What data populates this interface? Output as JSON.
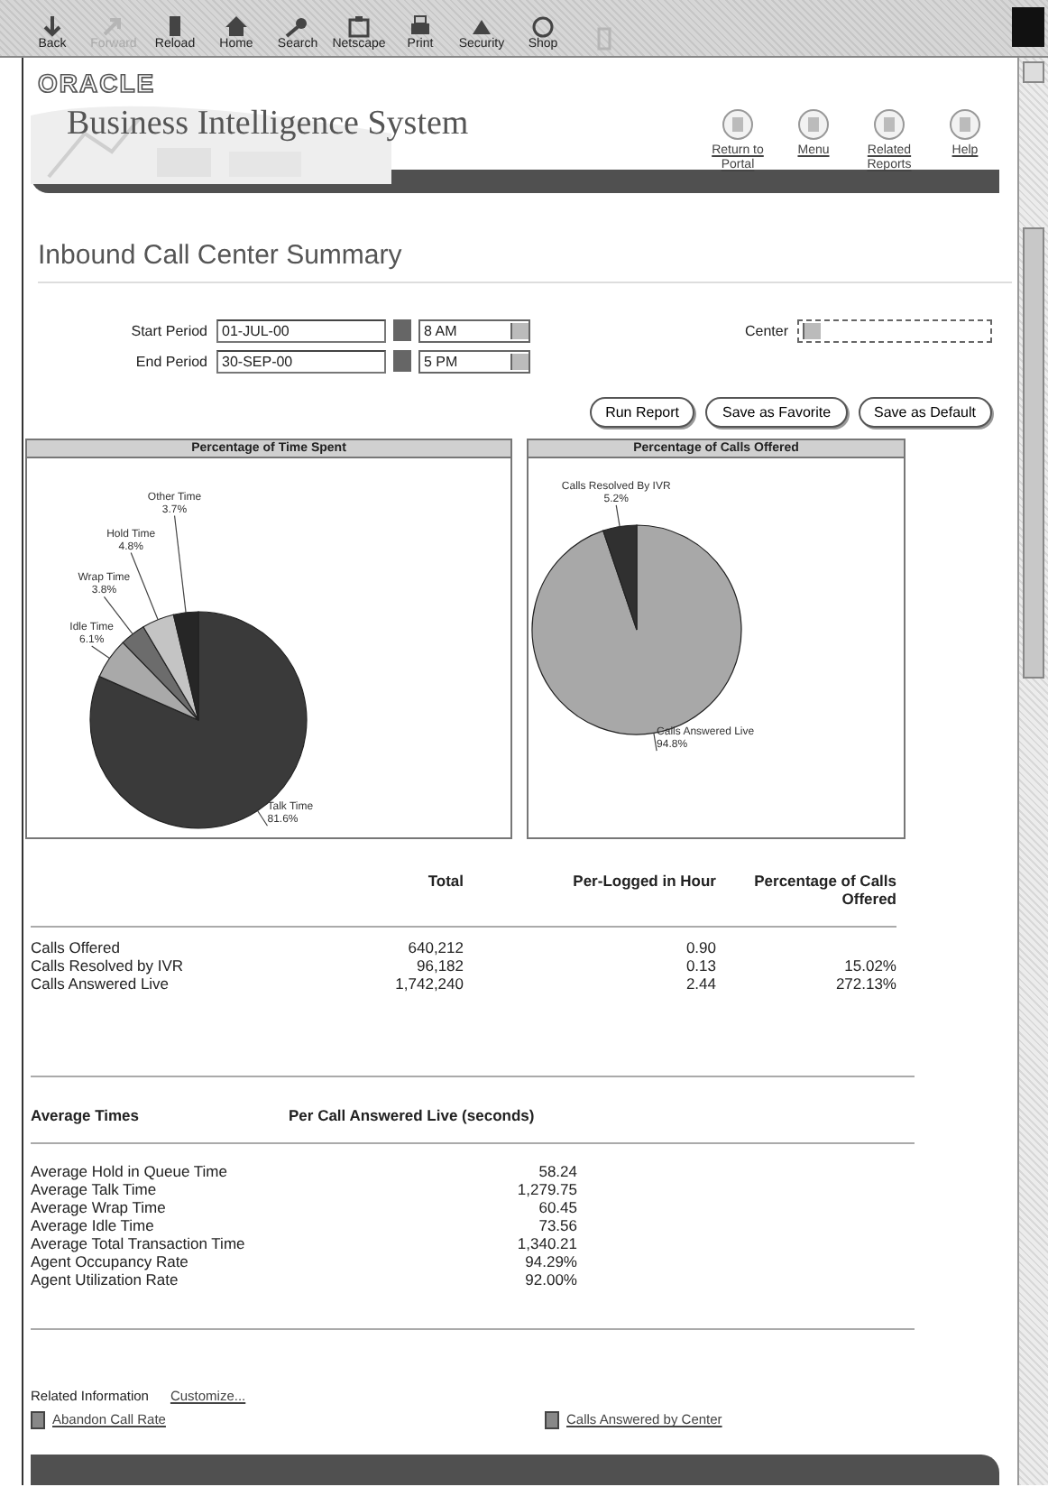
{
  "browser_toolbar": {
    "buttons": [
      {
        "kind": "labeled",
        "label": "Back",
        "disabled": false
      },
      {
        "kind": "labeled",
        "label": "Forward",
        "disabled": true
      },
      {
        "kind": "labeled",
        "label": "Reload",
        "disabled": false
      },
      {
        "kind": "labeled",
        "label": "Home",
        "disabled": false
      },
      {
        "kind": "labeled",
        "label": "Search",
        "disabled": false
      },
      {
        "kind": "labeled",
        "label": "Netscape",
        "disabled": false
      },
      {
        "kind": "labeled",
        "label": "Print",
        "disabled": false
      },
      {
        "kind": "labeled",
        "label": "Security",
        "disabled": false
      },
      {
        "kind": "labeled",
        "label": "Shop",
        "disabled": false
      },
      {
        "kind": "icon",
        "disabled": true
      }
    ]
  },
  "header": {
    "logo": "ORACLE",
    "title": "Business Intelligence System",
    "links": [
      {
        "label": "Return to Portal"
      },
      {
        "label": "Menu"
      },
      {
        "label": "Related Reports"
      },
      {
        "label": "Help"
      }
    ]
  },
  "report": {
    "title": "Inbound Call Center Summary",
    "start_period": {
      "label": "Start Period",
      "value": "01-JUL-00",
      "time": "8 AM"
    },
    "end_period": {
      "label": "End Period",
      "value": "30-SEP-00",
      "time": "5 PM"
    },
    "center": {
      "label": "Center"
    },
    "buttons": [
      "Run Report",
      "Save as Favorite",
      "Save as Default"
    ]
  },
  "charts": [
    {
      "chart_data": {
        "type": "pie",
        "title": "Percentage of Time Spent",
        "categories": [
          "Talk Time",
          "Idle Time",
          "Wrap Time",
          "Hold Time",
          "Other Time"
        ],
        "values": [
          81.6,
          6.1,
          3.8,
          4.8,
          3.7
        ],
        "value_labels": [
          "81.6%",
          "6.1%",
          "3.8%",
          "4.8%",
          "3.7%"
        ]
      }
    },
    {
      "chart_data": {
        "type": "pie",
        "title": "Percentage of Calls Offered",
        "categories": [
          "Calls Answered Live",
          "Calls Resolved By IVR"
        ],
        "values": [
          94.8,
          5.2
        ],
        "value_labels": [
          "94.8%",
          "5.2%"
        ]
      }
    }
  ],
  "calls_table": {
    "columns": [
      "Total",
      "Per-Logged in Hour",
      "Percentage of Calls Offered"
    ],
    "rows": [
      {
        "label": "Calls Offered",
        "cells": [
          "640,212",
          "0.90",
          ""
        ]
      },
      {
        "label": "Calls Resolved by IVR",
        "cells": [
          "96,182",
          "0.13",
          "15.02%"
        ]
      },
      {
        "label": "Calls Answered Live",
        "cells": [
          "1,742,240",
          "2.44",
          "272.13%"
        ]
      }
    ]
  },
  "times_table": {
    "columns": [
      "Average Times",
      "Per Call Answered Live (seconds)"
    ],
    "rows": [
      {
        "label": "Average Hold in Queue Time",
        "value": "58.24"
      },
      {
        "label": "Average Talk Time",
        "value": "1,279.75"
      },
      {
        "label": "Average Wrap Time",
        "value": "60.45"
      },
      {
        "label": "Average Idle Time",
        "value": "73.56"
      },
      {
        "label": "Average Total Transaction Time",
        "value": "1,340.21"
      },
      {
        "label": "Agent Occupancy Rate",
        "value": "94.29%"
      },
      {
        "label": "Agent Utilization Rate",
        "value": "92.00%"
      }
    ]
  },
  "related": {
    "label": "Related Information",
    "customize": "Customize...",
    "links": [
      "Abandon Call Rate",
      "Calls Answered by Center"
    ]
  }
}
